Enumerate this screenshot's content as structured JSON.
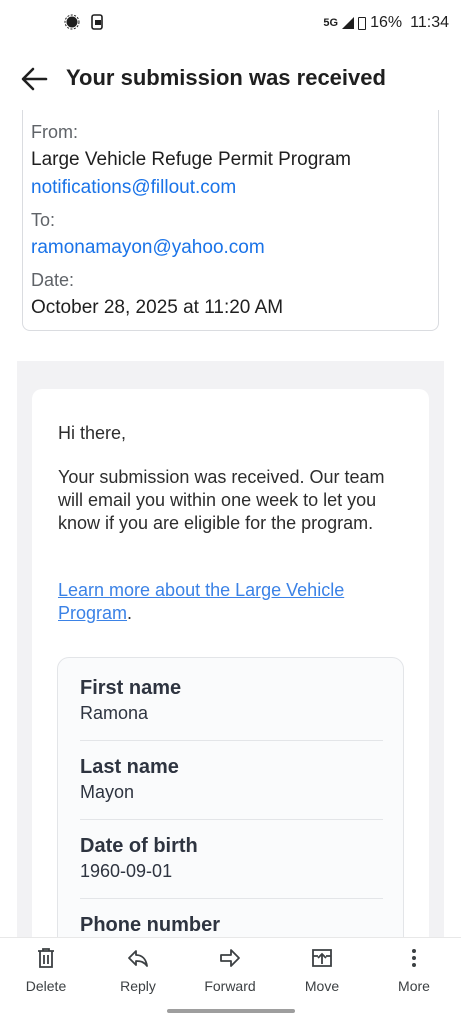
{
  "status_bar": {
    "network": "5G",
    "battery": "16%",
    "time": "11:34",
    "icons": [
      "notification-icon",
      "device-icon",
      "signal-icon",
      "battery-icon"
    ]
  },
  "header": {
    "title": "Your submission was received",
    "back_icon": "arrow-left-icon"
  },
  "details": {
    "from_label": "From:",
    "from_name": "Large Vehicle Refuge Permit Program",
    "from_email": "notifications@fillout.com",
    "to_label": "To:",
    "to_email": "ramonamayon@yahoo.com",
    "date_label": "Date:",
    "date_value": "October 28, 2025 at 11:20 AM"
  },
  "email": {
    "greeting": "Hi there,",
    "body": "Your submission was received. Our team will email you within one week to let you know if you are eligible for the program.",
    "link_text": "Learn more about the Large Vehicle Program",
    "link_suffix": ".",
    "fields": [
      {
        "label": "First name",
        "value": "Ramona"
      },
      {
        "label": "Last name",
        "value": "Mayon"
      },
      {
        "label": "Date of birth",
        "value": "1960-09-01"
      },
      {
        "label": "Phone number",
        "value": ""
      }
    ]
  },
  "toolbar": {
    "items": [
      {
        "label": "Delete",
        "icon": "trash-icon"
      },
      {
        "label": "Reply",
        "icon": "reply-icon"
      },
      {
        "label": "Forward",
        "icon": "forward-icon"
      },
      {
        "label": "Move",
        "icon": "move-icon"
      },
      {
        "label": "More",
        "icon": "more-vertical-icon"
      }
    ]
  },
  "colors": {
    "link": "#1a73e8",
    "email_link": "#3b82e6",
    "text": "#1f1f1f",
    "muted": "#5f6368",
    "mail_background": "#f2f2f4"
  }
}
